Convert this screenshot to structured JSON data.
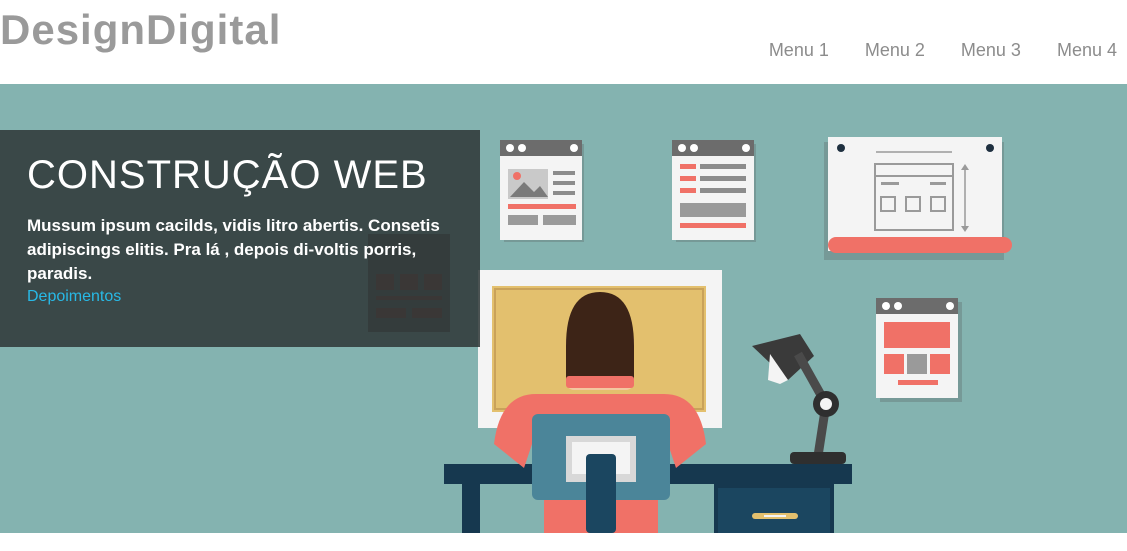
{
  "header": {
    "logo": "DesignDigital",
    "menu": [
      {
        "label": "Menu 1"
      },
      {
        "label": "Menu 2"
      },
      {
        "label": "Menu 3"
      },
      {
        "label": "Menu 4"
      }
    ]
  },
  "hero": {
    "title": "CONSTRUÇÃO WEB",
    "text": "Mussum ipsum cacilds, vidis litro abertis. Consetis adipiscings elitis. Pra lá , depois di-voltis porris, paradis.",
    "link": "Depoimentos"
  },
  "colors": {
    "hero_bg": "#84b3b0",
    "logo": "#9a9a9a",
    "menu": "#8c8c8c",
    "caption_bg": "#2d3737",
    "link": "#28b9e6",
    "accent": "#f07167"
  },
  "icons": [
    "browser-window-icon",
    "document-icon",
    "blueprint-icon",
    "web-layout-icon",
    "designer-illustration",
    "desk-lamp-icon",
    "monitor-icon"
  ]
}
